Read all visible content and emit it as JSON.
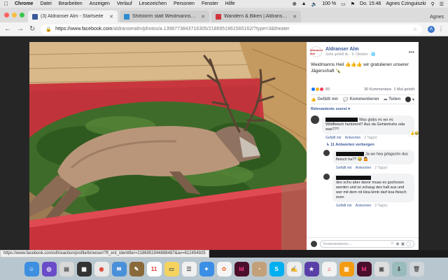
{
  "menubar": {
    "app": "Chrome",
    "items": [
      "Datei",
      "Bearbeiten",
      "Anzeigen",
      "Verlauf",
      "Lesezeichen",
      "Personen",
      "Fenster",
      "Hilfe"
    ],
    "battery": "100 %",
    "clock": "Do. 15:46",
    "user": "Agnes Czinguiszki"
  },
  "tabs": [
    {
      "title": "(3) Aldranser Alm - Startseite",
      "icon_color": "#3b5998"
    },
    {
      "title": "Shitstorm statt Weidmannsheil",
      "icon_color": "#2e8bd1"
    },
    {
      "title": "Wandern & Biken | Aldranser Alm",
      "icon_color": "#d0343c"
    }
  ],
  "profile_label": "Agnes",
  "address": {
    "host": "https://www.facebook.com",
    "path": "/aldranseralm/photos/a.1398773843716305/2186951861565162/?type=3&theater"
  },
  "post": {
    "page_name": "Aldranser Alm",
    "logo_text": "Aldranser Alm",
    "meta": "Seite gefällt dir · 9. Oktober · ",
    "caption": "Weidmanns Heil 👍👍👍 wir gratulieren unserer Jägerschaft 🍾",
    "reactions_count": "83",
    "comments_count": "30 Kommentare",
    "shares": "1 Mal geteilt",
    "like_label": "Gefällt mir",
    "comment_label": "Kommentieren",
    "share_label": "Teilen",
    "relevant_label": "Relevanteste zuerst ▾"
  },
  "comments": [
    {
      "text": "Was glabs es wo es Wildfleisch herkimmt? Aus da Gehiertruhe oda was???",
      "like": "Gefällt mir",
      "reply": "Antworten",
      "time": "2 Tag(e)",
      "badge": "13"
    },
    {
      "text": "Ja wo hea grlagschn dus fleisch ha?? 😂 🤷",
      "like": "Gefällt mir",
      "reply": "Antworten",
      "time": "2 Tag(e)"
    },
    {
      "text": "des schu aber davor muas es gschossn werden und so schaug des halt aus und wer mit dem nit kloa kimb darf koa fleisch essn",
      "like": "Gefällt mir",
      "reply": "Antworten",
      "time": "2 Tag(e)"
    }
  ],
  "hide_replies": "↳ 11 Antworten verbergen",
  "comment_placeholder": "Kommentieren ...",
  "status_url": "https://www.facebook.com/ufi/reaction/profile/browser/?ft_ent_identifier=2186951944898487&av=612454925",
  "dock_items": [
    "Finder",
    "Siri",
    "Launchpad",
    "Mission",
    "Chrome",
    "Mail",
    "Notes",
    "Calendar",
    "Stickies",
    "Reminders",
    "Safari",
    "Photos",
    "InDesign",
    "Contacts",
    "Skype",
    "TextEdit",
    "iMovie",
    "iTunes",
    "Books",
    "InDesign",
    "Preview",
    "Downloads",
    "Trash"
  ],
  "calendar_day": "11",
  "colors": {
    "facebook_blue": "#3b5998",
    "link_blue": "#385898",
    "wood": "#c9a06a",
    "crate_red": "#c8323a"
  }
}
